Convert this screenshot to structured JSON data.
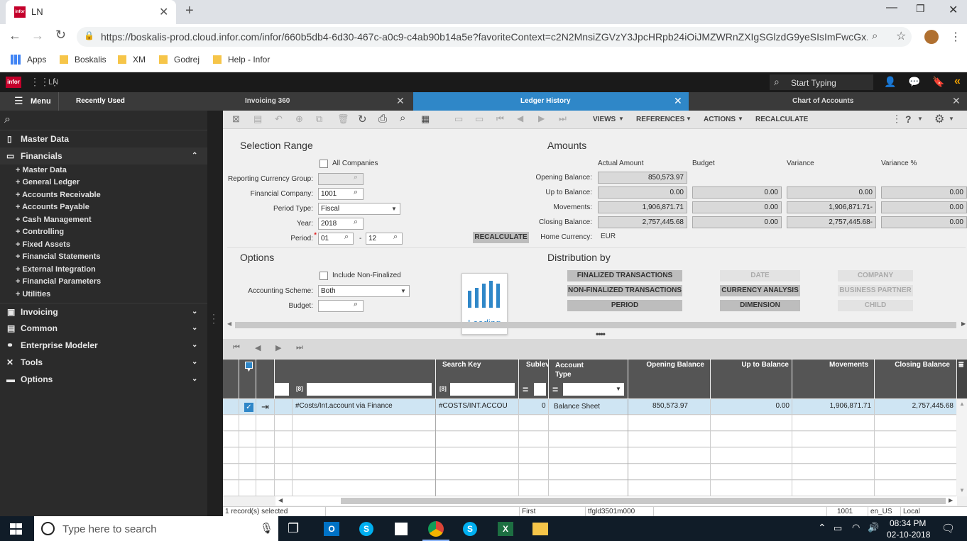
{
  "browser": {
    "tab_title": "LN",
    "url": "https://boskalis-prod.cloud.infor.com/infor/660b5db4-6d30-467c-a0c9-c4ab90b14a5e?favoriteContext=c2N2MnsiZGVzY3JpcHRpb24iOiJMZWRnZXIgSGlzdG9yeSIsImFwcGx...",
    "bookmarks": [
      "Apps",
      "Boskalis",
      "XM",
      "Godrej",
      "Help - Infor"
    ]
  },
  "infor": {
    "logo": "infor",
    "app": "LN",
    "search_placeholder": "Start Typing"
  },
  "apptabs": {
    "menu": "Menu",
    "recent": "Recently Used",
    "tabs": [
      "Invoicing 360",
      "Ledger History",
      "Chart of Accounts"
    ]
  },
  "sidebar": {
    "sections": [
      "Master Data",
      "Financials",
      "Invoicing",
      "Common",
      "Enterprise Modeler",
      "Tools",
      "Options"
    ],
    "financials_items": [
      "Master Data",
      "General Ledger",
      "Accounts Receivable",
      "Accounts Payable",
      "Cash Management",
      "Controlling",
      "Fixed Assets",
      "Financial Statements",
      "External Integration",
      "Financial Parameters",
      "Utilities"
    ]
  },
  "toolbar": {
    "views": "VIEWS",
    "references": "REFERENCES",
    "actions": "ACTIONS",
    "recalculate": "RECALCULATE",
    "help": "?"
  },
  "selection": {
    "title": "Selection Range",
    "all_companies": "All Companies",
    "reporting_currency_group": "Reporting Currency Group:",
    "financial_company": "Financial Company:",
    "financial_company_value": "1001",
    "period_type": "Period Type:",
    "period_type_value": "Fiscal",
    "year": "Year:",
    "year_value": "2018",
    "period": "Period:",
    "period_from": "01",
    "period_sep": "-",
    "period_to": "12",
    "recalc_button": "RECALCULATE"
  },
  "amounts": {
    "title": "Amounts",
    "headers": [
      "Actual Amount",
      "Budget",
      "Variance",
      "Variance %"
    ],
    "opening_balance": "Opening Balance:",
    "opening_actual": "850,573.97",
    "up_to_balance": "Up to Balance:",
    "up_to_values": [
      "0.00",
      "0.00",
      "0.00",
      "0.00"
    ],
    "movements": "Movements:",
    "movements_values": [
      "1,906,871.71",
      "0.00",
      "1,906,871.71-",
      "0.00"
    ],
    "closing_balance": "Closing Balance:",
    "closing_values": [
      "2,757,445.68",
      "0.00",
      "2,757,445.68-",
      "0.00"
    ],
    "home_currency": "Home Currency:",
    "home_currency_value": "EUR"
  },
  "options": {
    "title": "Options",
    "include_non_finalized": "Include Non-Finalized",
    "accounting_scheme": "Accounting Scheme:",
    "accounting_scheme_value": "Both",
    "budget": "Budget:"
  },
  "loading": "Loading",
  "distribution": {
    "title": "Distribution by",
    "buttons": [
      "FINALIZED TRANSACTIONS",
      "DATE",
      "COMPANY",
      "NON-FINALIZED TRANSACTIONS",
      "CURRENCY ANALYSIS",
      "BUSINESS PARTNER",
      "PERIOD",
      "DIMENSION",
      "CHILD"
    ]
  },
  "grid": {
    "headers": [
      "Search Key",
      "Sublev",
      "Account Type",
      "Opening Balance",
      "Up to Balance",
      "Movements",
      "Closing Balance"
    ],
    "filter_prefix": "[8]",
    "filter_eq": "=",
    "row": {
      "account": "#Costs/Int.account via Finance",
      "search_key": "#COSTS/INT.ACCOU",
      "sublevel": "0",
      "account_type": "Balance Sheet",
      "opening": "850,573.97",
      "up_to": "0.00",
      "movements": "1,906,871.71",
      "closing": "2,757,445.68"
    }
  },
  "status": {
    "selected": "1 record(s) selected",
    "first": "First",
    "session": "tfgld3501m000",
    "company": "1001",
    "locale": "en_US",
    "local": "Local"
  },
  "taskbar": {
    "search_placeholder": "Type here to search",
    "time": "08:34 PM",
    "date": "02-10-2018"
  }
}
